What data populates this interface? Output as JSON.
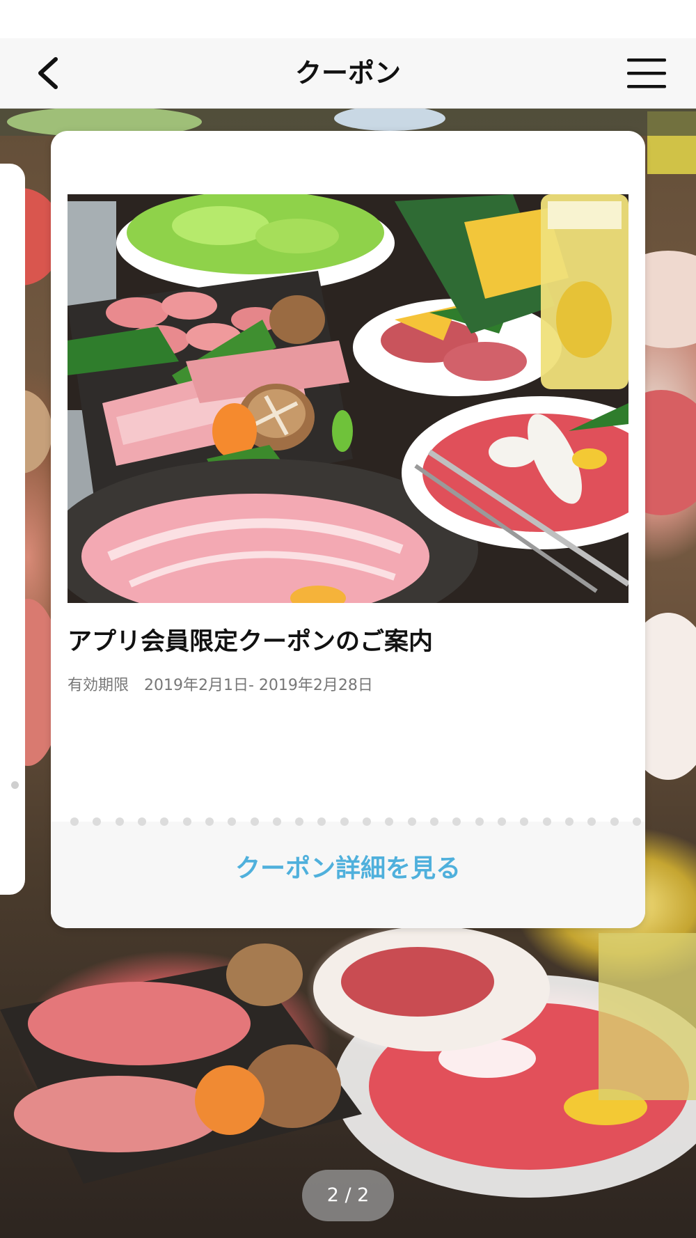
{
  "nav": {
    "title": "クーポン",
    "back_icon": "chevron-left-icon",
    "menu_icon": "hamburger-menu-icon"
  },
  "coupon": {
    "title": "アプリ会員限定クーポンのご案内",
    "validity_label": "有効期限",
    "validity_range": "2019年2月1日- 2019年2月28日",
    "detail_link": "クーポン詳細を見る",
    "image_description": "yakiniku-platter-photo"
  },
  "pager": {
    "text": "2 / 2"
  },
  "colors": {
    "accent": "#4fb0dc",
    "nav_bg": "#f7f7f7",
    "card_bg": "#ffffff",
    "muted_text": "#777777"
  }
}
